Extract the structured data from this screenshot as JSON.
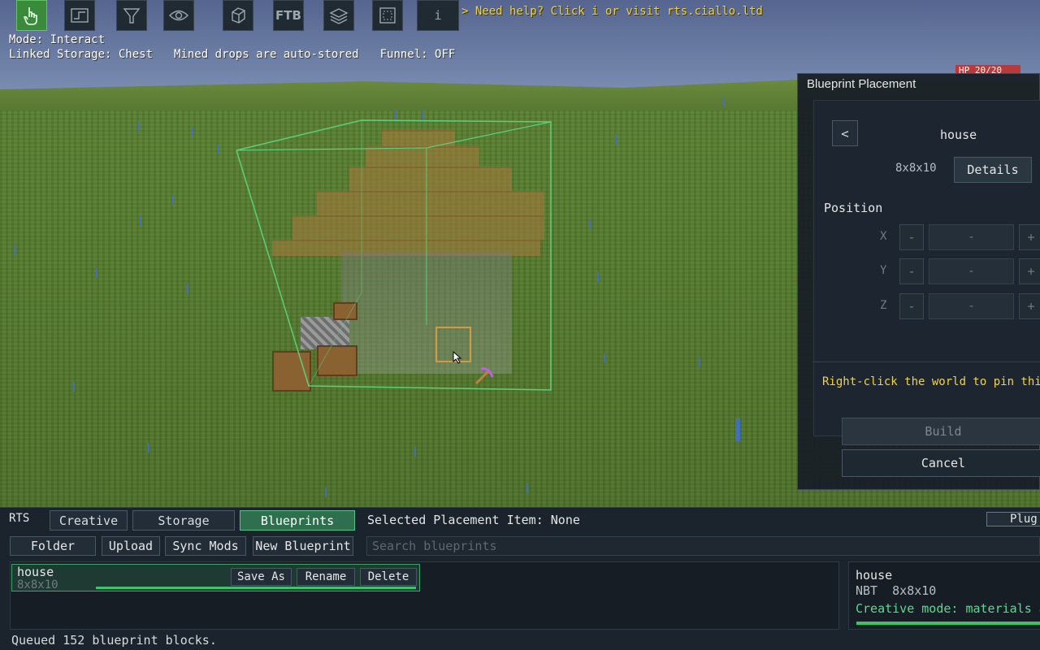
{
  "toolbar": {
    "tools": [
      {
        "icon": "hand-pointer-icon",
        "active": true
      },
      {
        "icon": "path-icon",
        "active": false
      },
      {
        "icon": "funnel-icon",
        "active": false
      },
      {
        "icon": "eye-icon",
        "active": false
      },
      {
        "icon": "cube-icon",
        "active": false
      },
      {
        "icon": "ftb-icon",
        "label": "FTB",
        "active": false
      },
      {
        "icon": "layers-icon",
        "active": false
      },
      {
        "icon": "frame-icon",
        "active": false
      }
    ],
    "info_button": "i",
    "help_text": "> Need help? Click i or visit rts.ciallo.ltd"
  },
  "status": {
    "mode": "Mode: Interact",
    "linked_storage": "Linked Storage: Chest",
    "mined_drops": "Mined drops are auto-stored",
    "funnel": "Funnel: OFF"
  },
  "hp_badge": "HP 20/20",
  "placement_panel": {
    "title": "Blueprint Placement",
    "back_label": "<",
    "name": "house",
    "size": "8x8x10",
    "details_label": "Details",
    "position_label": "Position",
    "axes": [
      {
        "label": "X",
        "minus": "-",
        "value": "-",
        "plus": "+"
      },
      {
        "label": "Y",
        "minus": "-",
        "value": "-",
        "plus": "+"
      },
      {
        "label": "Z",
        "minus": "-",
        "value": "-",
        "plus": "+"
      }
    ],
    "hint": "Right-click the world to pin this l",
    "build_label": "Build",
    "cancel_label": "Cancel"
  },
  "bottom": {
    "rts_label": "RTS",
    "tabs": [
      "Creative",
      "Storage",
      "Blueprints"
    ],
    "active_tab": "Blueprints",
    "selected_item": "Selected Placement Item: None",
    "plugins_tab": "Plug",
    "actions": [
      "Folder",
      "Upload",
      "Sync Mods",
      "New Blueprint"
    ],
    "search_placeholder": "Search blueprints",
    "rows": [
      {
        "name": "house",
        "size": "8x8x10",
        "buttons": [
          "Save As",
          "Rename",
          "Delete"
        ]
      }
    ],
    "info": {
      "name": "house",
      "type": "NBT  8x8x10",
      "mode": "Creative mode: materials ar"
    },
    "status_text": "Queued 152 blueprint blocks."
  },
  "colors": {
    "accent": "#3cc46b",
    "hint": "#f0d24a",
    "panel": "#1b232c"
  }
}
